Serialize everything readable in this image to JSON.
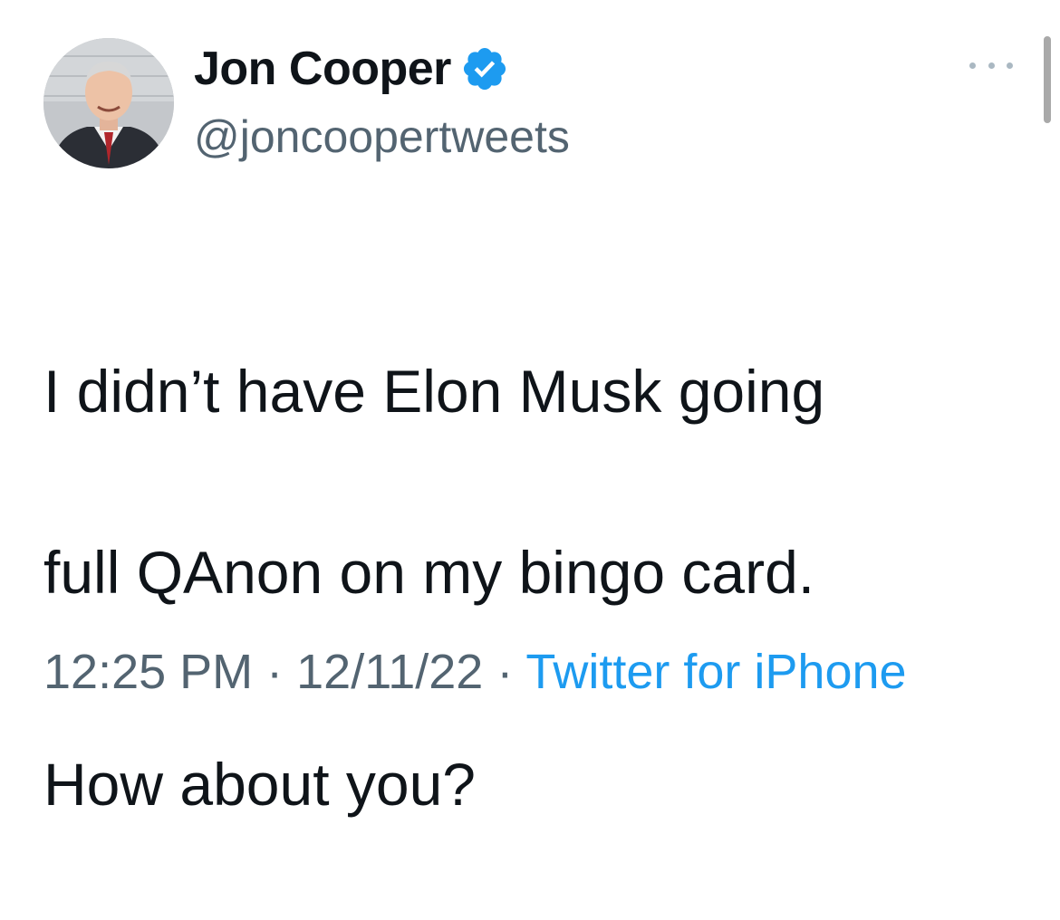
{
  "author": {
    "display_name": "Jon Cooper",
    "handle": "@joncoopertweets",
    "verified": true
  },
  "tweet": {
    "line1": "I didn’t have Elon Musk going",
    "line2": "full QAnon on my bingo card.",
    "paragraph2": "How about you?"
  },
  "meta": {
    "time": "12:25 PM",
    "separator": " · ",
    "date": "12/11/22",
    "source": "Twitter for iPhone"
  },
  "colors": {
    "verified_badge": "#1d9bf0",
    "link": "#1d9bf0",
    "secondary_text": "#536471"
  },
  "icons": {
    "verified": "verified-badge-icon",
    "more": "more-options-icon"
  }
}
